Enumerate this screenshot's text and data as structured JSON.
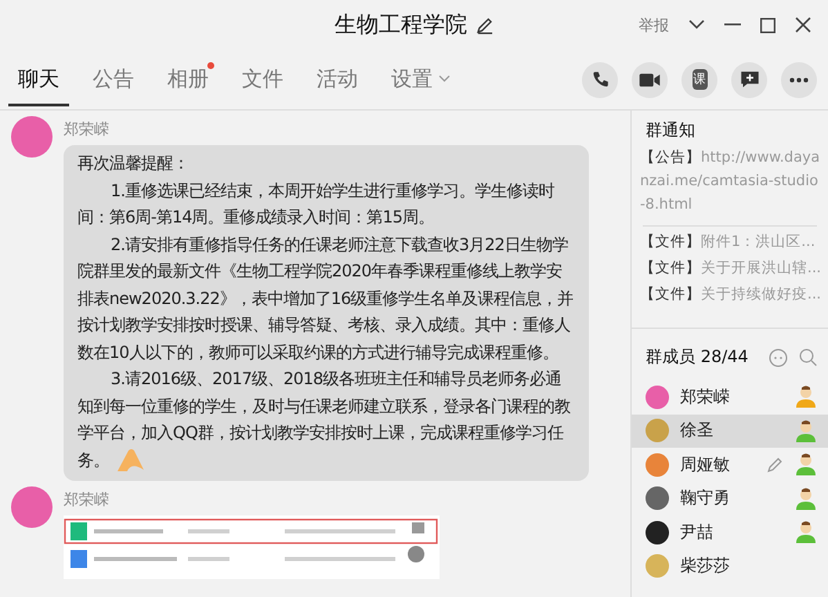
{
  "window": {
    "title": "生物工程学院",
    "report": "举报"
  },
  "tabs": [
    {
      "label": "聊天",
      "selected": true,
      "dot": false,
      "menu": false
    },
    {
      "label": "公告",
      "selected": false,
      "dot": false,
      "menu": false
    },
    {
      "label": "相册",
      "selected": false,
      "dot": true,
      "menu": false
    },
    {
      "label": "文件",
      "selected": false,
      "dot": false,
      "menu": false
    },
    {
      "label": "活动",
      "selected": false,
      "dot": false,
      "menu": false
    },
    {
      "label": "设置",
      "selected": false,
      "dot": false,
      "menu": true
    }
  ],
  "toolbar": [
    {
      "kind": "phone"
    },
    {
      "kind": "video"
    },
    {
      "kind": "class",
      "label": "课"
    },
    {
      "kind": "message"
    },
    {
      "kind": "more"
    }
  ],
  "messages": [
    {
      "sender": "郑荣嵘",
      "kind": "text",
      "paragraphs": [
        {
          "text": "再次温馨提醒：",
          "indent": false
        },
        {
          "text": "1.重修选课已经结束，本周开始学生进行重修学习。学生修读时间：第6周-第14周。重修成绩录入时间：第15周。",
          "indent": true
        },
        {
          "text": "2.请安排有重修指导任务的任课老师注意下载查收3月22日生物学院群里发的最新文件《生物工程学院2020年春季课程重修线上教学安排表new2020.3.22》，表中增加了16级重修学生名单及课程信息，并按计划教学安排按时授课、辅导答疑、考核、录入成绩。其中：重修人数在10人以下的，教师可以采取约课的方式进行辅导完成课程重修。",
          "indent": true
        },
        {
          "text": "3.请2016级、2017级、2018级各班班主任和辅导员老师务必通知到每一位重修的学生，及时与任课老师建立联系，登录各门课程的教学平台，加入QQ群，按计划教学安排按时上课，完成课程重修学习任务。",
          "indent": true
        }
      ]
    },
    {
      "sender": "郑荣嵘",
      "kind": "picture"
    }
  ],
  "notices": {
    "title": "群通知",
    "items": [
      {
        "tag": "【公告】",
        "text": "http://www.dayanzai.me/camtasia-studio-8.html",
        "kind": "announcement"
      },
      {
        "tag": "【文件】",
        "text": "附件1：洪山区...",
        "kind": "file"
      },
      {
        "tag": "【文件】",
        "text": "关于开展洪山辖...",
        "kind": "file"
      },
      {
        "tag": "【文件】",
        "text": "关于持续做好疫...",
        "kind": "file"
      }
    ]
  },
  "members": {
    "title": "群成员 28/44",
    "items": [
      {
        "name": "郑荣嵘",
        "selected": false,
        "kind": "owner",
        "editable": false,
        "color": "#e85fa8"
      },
      {
        "name": "徐圣",
        "selected": true,
        "kind": "admin",
        "editable": false,
        "color": "#c9a24a"
      },
      {
        "name": "周娅敏",
        "selected": false,
        "kind": "admin",
        "editable": true,
        "color": "#e8843a"
      },
      {
        "name": "鞠守勇",
        "selected": false,
        "kind": "admin",
        "editable": false,
        "color": "#666666"
      },
      {
        "name": "尹喆",
        "selected": false,
        "kind": "admin",
        "editable": false,
        "color": "#222222"
      },
      {
        "name": "柴莎莎",
        "selected": false,
        "kind": "member",
        "editable": false,
        "color": "#d7b45a"
      }
    ]
  }
}
